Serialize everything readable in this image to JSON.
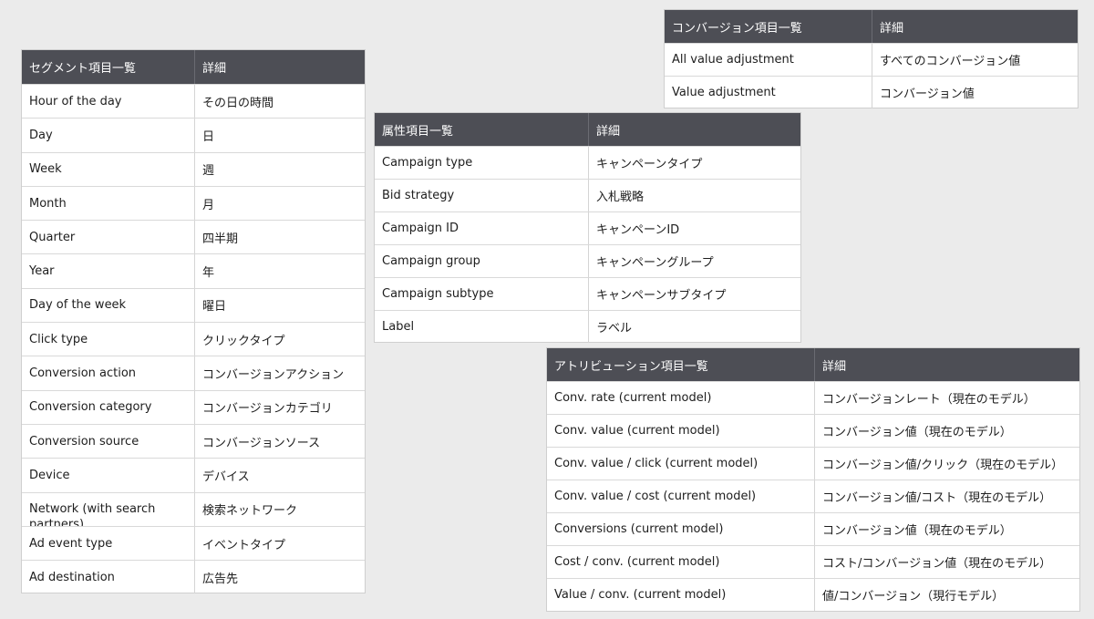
{
  "segment_table": {
    "header": {
      "item": "セグメント項目一覧",
      "detail": "詳細"
    },
    "rows": [
      {
        "item": "Hour of the day",
        "detail": "その日の時間"
      },
      {
        "item": "Day",
        "detail": "日"
      },
      {
        "item": "Week",
        "detail": "週"
      },
      {
        "item": "Month",
        "detail": "月"
      },
      {
        "item": "Quarter",
        "detail": "四半期"
      },
      {
        "item": "Year",
        "detail": "年"
      },
      {
        "item": "Day of the week",
        "detail": "曜日"
      },
      {
        "item": "Click type",
        "detail": "クリックタイプ"
      },
      {
        "item": "Conversion action",
        "detail": "コンバージョンアクション"
      },
      {
        "item": "Conversion category",
        "detail": "コンバージョンカテゴリ"
      },
      {
        "item": "Conversion source",
        "detail": "コンバージョンソース"
      },
      {
        "item": "Device",
        "detail": "デバイス"
      },
      {
        "item": "Network (with search partners)",
        "detail": "検索ネットワーク"
      },
      {
        "item": "Ad event type",
        "detail": "イベントタイプ"
      },
      {
        "item": "Ad destination",
        "detail": "広告先"
      }
    ]
  },
  "attribute_table": {
    "header": {
      "item": "属性項目一覧",
      "detail": "詳細"
    },
    "rows": [
      {
        "item": "Campaign type",
        "detail": "キャンペーンタイプ"
      },
      {
        "item": "Bid strategy",
        "detail": "入札戦略"
      },
      {
        "item": "Campaign ID",
        "detail": "キャンペーンID"
      },
      {
        "item": "Campaign group",
        "detail": "キャンペーングループ"
      },
      {
        "item": "Campaign subtype",
        "detail": "キャンペーンサブタイプ"
      },
      {
        "item": "Label",
        "detail": "ラベル"
      }
    ]
  },
  "conversion_table": {
    "header": {
      "item": "コンバージョン項目一覧",
      "detail": "詳細"
    },
    "rows": [
      {
        "item": "All value adjustment",
        "detail": "すべてのコンバージョン値"
      },
      {
        "item": "Value adjustment",
        "detail": "コンバージョン値"
      }
    ]
  },
  "attribution_table": {
    "header": {
      "item": "アトリビューション項目一覧",
      "detail": "詳細"
    },
    "rows": [
      {
        "item": "Conv. rate (current model)",
        "detail": "コンバージョンレート（現在のモデル）"
      },
      {
        "item": "Conv. value (current model)",
        "detail": "コンバージョン値（現在のモデル）"
      },
      {
        "item": "Conv. value / click (current model)",
        "detail": "コンバージョン値/クリック（現在のモデル）"
      },
      {
        "item": "Conv. value / cost (current model)",
        "detail": "コンバージョン値/コスト（現在のモデル）"
      },
      {
        "item": "Conversions (current model)",
        "detail": "コンバージョン値（現在のモデル）"
      },
      {
        "item": "Cost / conv. (current model)",
        "detail": "コスト/コンバージョン値（現在のモデル）"
      },
      {
        "item": "Value / conv. (current model)",
        "detail": "値/コンバージョン（現行モデル）"
      }
    ]
  },
  "colors": {
    "background": "#ebebeb",
    "header_bg": "#4d4e55",
    "header_text": "#ffffff",
    "cell_bg": "#ffffff",
    "border": "#d9d9d9"
  }
}
